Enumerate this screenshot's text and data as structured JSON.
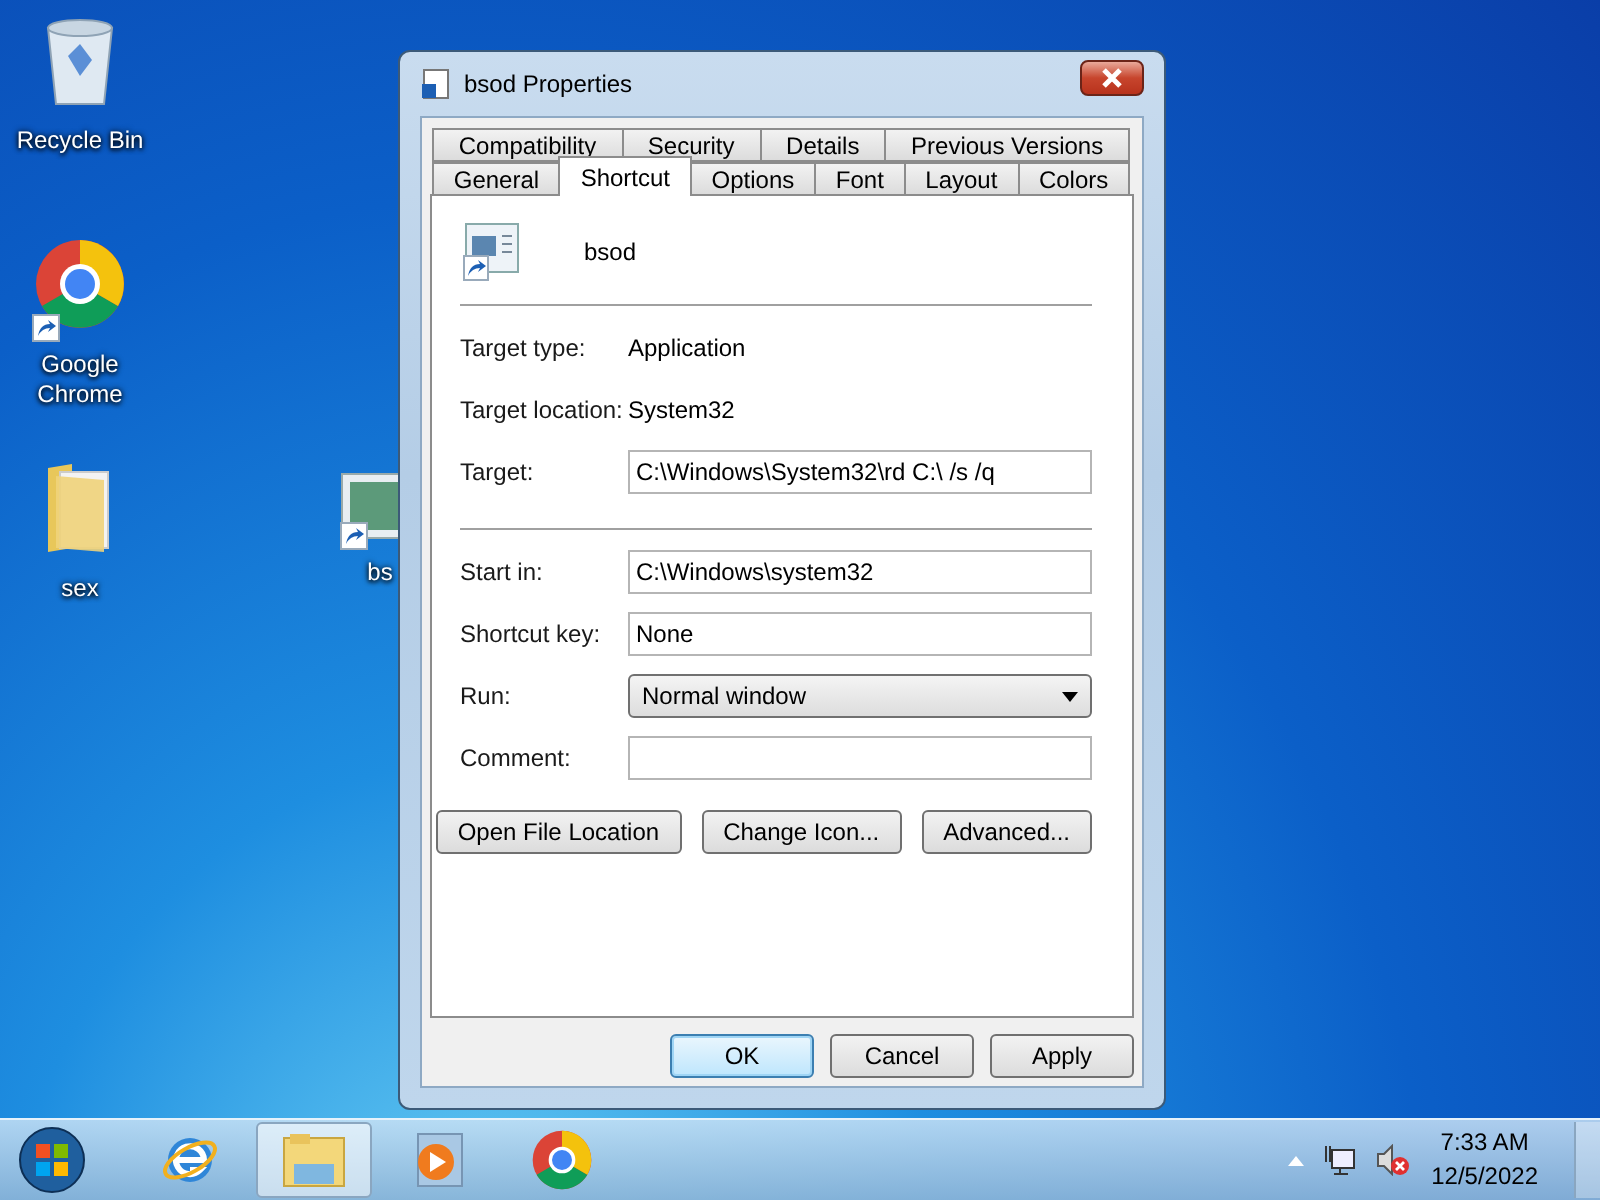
{
  "desktop_icons": [
    {
      "kind": "recycle-bin",
      "label": "Recycle Bin",
      "shortcut": false
    },
    {
      "kind": "chrome",
      "label": "Google Chrome",
      "shortcut": true
    },
    {
      "kind": "folder",
      "label": "sex",
      "shortcut": false
    }
  ],
  "hidden_icon": {
    "label": "bs"
  },
  "window": {
    "title": "bsod Properties",
    "tab_rows": [
      [
        {
          "label": "Compatibility",
          "selected": false
        },
        {
          "label": "Security",
          "selected": false
        },
        {
          "label": "Details",
          "selected": false
        },
        {
          "label": "Previous Versions",
          "selected": false
        }
      ],
      [
        {
          "label": "General",
          "selected": false
        },
        {
          "label": "Shortcut",
          "selected": true
        },
        {
          "label": "Options",
          "selected": false
        },
        {
          "label": "Font",
          "selected": false
        },
        {
          "label": "Layout",
          "selected": false
        },
        {
          "label": "Colors",
          "selected": false
        }
      ]
    ],
    "shortcut_name": "bsod",
    "sections": [
      [
        {
          "kind": "info",
          "label": "Target type:",
          "value": "Application"
        },
        {
          "kind": "info",
          "label": "Target location:",
          "value": "System32"
        },
        {
          "kind": "text",
          "label": "Target:",
          "value": "C:\\Windows\\System32\\rd C:\\ /s /q"
        }
      ],
      [
        {
          "kind": "text",
          "label": "Start in:",
          "value": "C:\\Windows\\system32"
        },
        {
          "kind": "text",
          "label": "Shortcut key:",
          "value": "None"
        },
        {
          "kind": "dropdown",
          "label": "Run:",
          "value": "Normal window"
        },
        {
          "kind": "text",
          "label": "Comment:"
        }
      ]
    ],
    "action_buttons": [
      "Open File Location",
      "Change Icon...",
      "Advanced..."
    ],
    "dialog_buttons": [
      {
        "label": "OK",
        "default": true
      },
      {
        "label": "Cancel",
        "default": false
      },
      {
        "label": "Apply",
        "default": false
      }
    ]
  },
  "taskbar": {
    "apps": [
      {
        "kind": "ie",
        "active": false
      },
      {
        "kind": "explorer",
        "active": true
      },
      {
        "kind": "media",
        "active": false
      },
      {
        "kind": "chrome",
        "active": false
      }
    ],
    "time": "7:33 AM",
    "date": "12/5/2022"
  }
}
